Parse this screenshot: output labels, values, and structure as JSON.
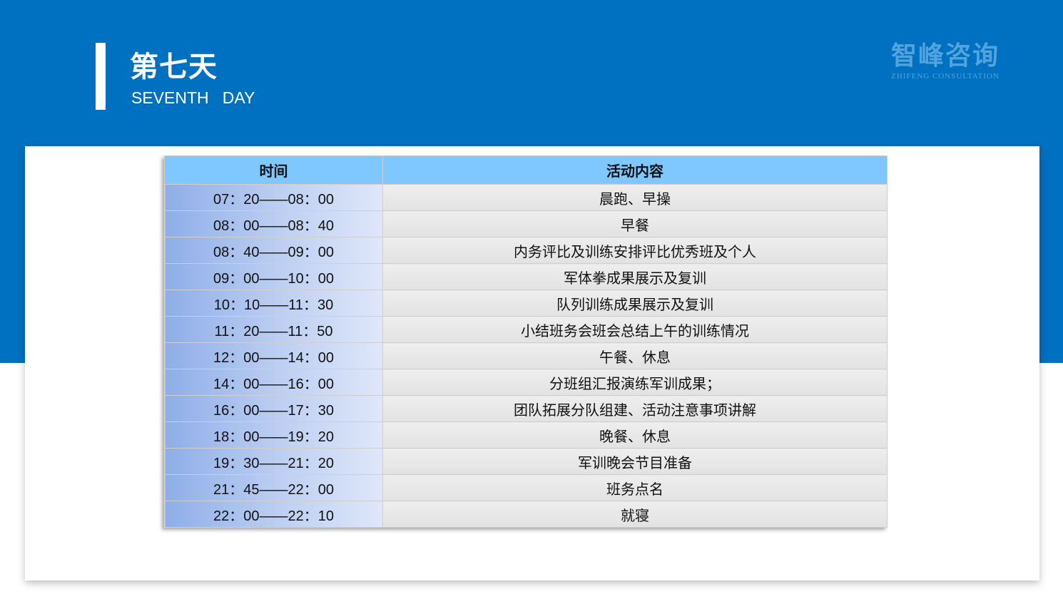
{
  "header": {
    "title_cn": "第七天",
    "title_en": "SEVENTH   DAY",
    "accent_color": "#0070c0"
  },
  "logo": {
    "name_cn": "智峰咨询",
    "name_en": "ZHIFENG CONSULTATION"
  },
  "table": {
    "headers": [
      "时间",
      "活动内容"
    ],
    "rows": [
      {
        "time": "07：20——08：00",
        "activity": "晨跑、早操"
      },
      {
        "time": "08：00——08：40",
        "activity": "早餐"
      },
      {
        "time": "08：40——09：00",
        "activity": "内务评比及训练安排评比优秀班及个人"
      },
      {
        "time": "09：00——10：00",
        "activity": "军体拳成果展示及复训"
      },
      {
        "time": "10：10——11：30",
        "activity": "队列训练成果展示及复训"
      },
      {
        "time": "11：20——11：50",
        "activity": "小结班务会班会总结上午的训练情况"
      },
      {
        "time": "12：00——14：00",
        "activity": "午餐、休息"
      },
      {
        "time": "14：00——16：00",
        "activity": "分班组汇报演练军训成果；"
      },
      {
        "time": "16：00——17：30",
        "activity": "团队拓展分队组建、活动注意事项讲解"
      },
      {
        "time": "18：00——19：20",
        "activity": "晚餐、休息"
      },
      {
        "time": "19：30——21：20",
        "activity": "军训晚会节目准备"
      },
      {
        "time": "21：45——22：00",
        "activity": "班务点名"
      },
      {
        "time": "22：00——22：10",
        "activity": "就寝"
      }
    ]
  }
}
